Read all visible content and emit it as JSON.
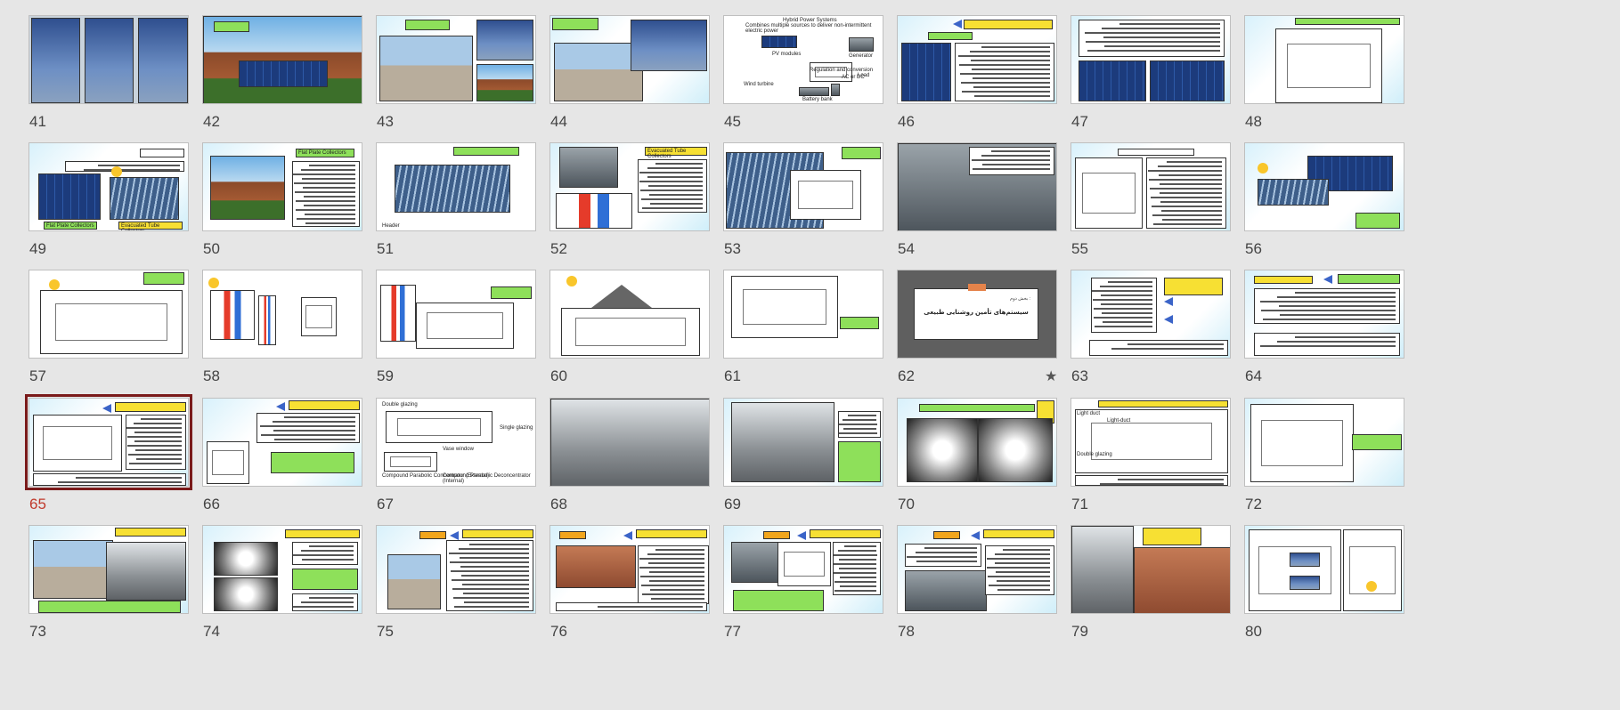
{
  "colors": {
    "background": "#e6e6e6",
    "selected_outline": "#7a1a1a",
    "selected_number": "#c0392b",
    "tag_green": "#8ee05a",
    "tag_yellow": "#f7e033"
  },
  "view": "slide-sorter",
  "selected_slide": 65,
  "slides": [
    {
      "number": "41",
      "style": "photo",
      "layout": "turbines"
    },
    {
      "number": "42",
      "style": "photo",
      "layout": "roof"
    },
    {
      "number": "43",
      "style": "light",
      "layout": "three-photos"
    },
    {
      "number": "44",
      "style": "light",
      "layout": "two-photos"
    },
    {
      "number": "45",
      "style": "white",
      "layout": "hybrid",
      "title": "Hybrid Power Systems",
      "subtitle": "Combines multiple sources to deliver non-intermittent electric power",
      "labels": [
        "PV modules",
        "Generator",
        "Wind turbine",
        "Regulation and conversion",
        "AC or DC",
        "Load",
        "Battery bank"
      ]
    },
    {
      "number": "46",
      "style": "light",
      "layout": "panel-text"
    },
    {
      "number": "47",
      "style": "light",
      "layout": "text-two-panels"
    },
    {
      "number": "48",
      "style": "light",
      "layout": "diagram-box"
    },
    {
      "number": "49",
      "style": "light",
      "layout": "two-diagrams",
      "labels": [
        "Flat Plate Collectors",
        "Evacuated Tube Collectors"
      ]
    },
    {
      "number": "50",
      "style": "light",
      "layout": "photo-text",
      "labels": [
        "Flat Plate Collectors"
      ]
    },
    {
      "number": "51",
      "style": "white",
      "layout": "collector-diagram",
      "labels": [
        "Header"
      ]
    },
    {
      "number": "52",
      "style": "light",
      "layout": "tube-text",
      "labels": [
        "Evacuated Tube Collectors"
      ]
    },
    {
      "number": "53",
      "style": "white",
      "layout": "tubes"
    },
    {
      "number": "54",
      "style": "light",
      "layout": "photo-text-right"
    },
    {
      "number": "55",
      "style": "light",
      "layout": "schematic-text"
    },
    {
      "number": "56",
      "style": "light",
      "layout": "sun-collector"
    },
    {
      "number": "57",
      "style": "white",
      "layout": "sun-schematic"
    },
    {
      "number": "58",
      "style": "white",
      "layout": "tank-schematic"
    },
    {
      "number": "59",
      "style": "white",
      "layout": "color-schematic"
    },
    {
      "number": "60",
      "style": "white",
      "layout": "house"
    },
    {
      "number": "61",
      "style": "white",
      "layout": "faint"
    },
    {
      "number": "62",
      "style": "dark",
      "layout": "section",
      "title": "سیستم‌های تأمین روشنایی طبیعی",
      "subtitle": "بخش دوم :",
      "starred": true
    },
    {
      "number": "63",
      "style": "light",
      "layout": "arrows-text"
    },
    {
      "number": "64",
      "style": "light",
      "layout": "text-only"
    },
    {
      "number": "65",
      "style": "light",
      "layout": "selected-diagram"
    },
    {
      "number": "66",
      "style": "light",
      "layout": "text-diagram"
    },
    {
      "number": "67",
      "style": "white",
      "layout": "glazing",
      "labels": [
        "Double glazing",
        "Single glazing",
        "Vase window",
        "Compound Parabolic Concentrator (External)",
        "Compound Parabolic Deconcentrator (Internal)"
      ]
    },
    {
      "number": "68",
      "style": "photo",
      "layout": "interior"
    },
    {
      "number": "69",
      "style": "light",
      "layout": "bw-photo-text"
    },
    {
      "number": "70",
      "style": "light",
      "layout": "two-fisheye"
    },
    {
      "number": "71",
      "style": "white",
      "layout": "light-duct",
      "labels": [
        "Light duct",
        "Light-duct",
        "Double glazing"
      ]
    },
    {
      "number": "72",
      "style": "light",
      "layout": "prisms"
    },
    {
      "number": "73",
      "style": "light",
      "layout": "two-photos-low"
    },
    {
      "number": "74",
      "style": "light",
      "layout": "bw-two"
    },
    {
      "number": "75",
      "style": "light",
      "layout": "light-pipe"
    },
    {
      "number": "76",
      "style": "light",
      "layout": "pipe-text"
    },
    {
      "number": "77",
      "style": "light",
      "layout": "dome-text"
    },
    {
      "number": "78",
      "style": "light",
      "layout": "roof-domes"
    },
    {
      "number": "79",
      "style": "light",
      "layout": "interior-roof"
    },
    {
      "number": "80",
      "style": "light",
      "layout": "pipe-diagram"
    }
  ]
}
